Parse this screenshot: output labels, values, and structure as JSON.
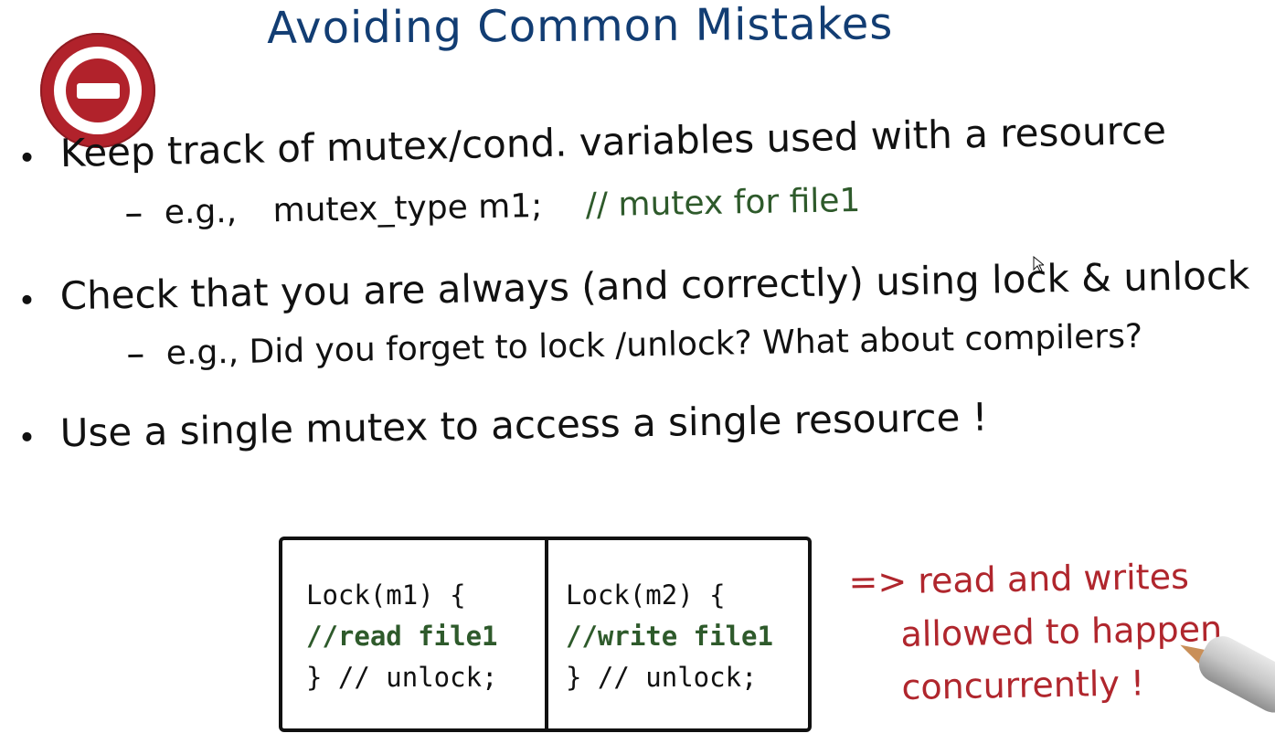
{
  "title": "Avoiding Common Mistakes",
  "bullets": [
    {
      "text": "Keep track of mutex/cond. variables used with a resource",
      "sub": {
        "prefix": "e.g.,",
        "code": "mutex_type m1;",
        "comment": "// mutex for file1"
      }
    },
    {
      "text": "Check that you are always (and correctly) using lock & unlock",
      "sub": {
        "text": "e.g., Did you forget to lock /unlock? What about compilers?"
      }
    },
    {
      "text": "Use a single mutex to access a single resource !"
    }
  ],
  "code_panels": [
    {
      "line1": "Lock(m1) {",
      "line2": "//read file1",
      "line3": "} // unlock;"
    },
    {
      "line1": "Lock(m2) {",
      "line2": "//write file1",
      "line3": "} // unlock;"
    }
  ],
  "note": {
    "line1": "=> read and writes",
    "line2": "allowed to happen",
    "line3": "concurrently !"
  },
  "colors": {
    "title": "#123d73",
    "ink": "#111111",
    "green": "#2e5a2b",
    "red": "#b0262d",
    "icon": "#b1222b"
  }
}
